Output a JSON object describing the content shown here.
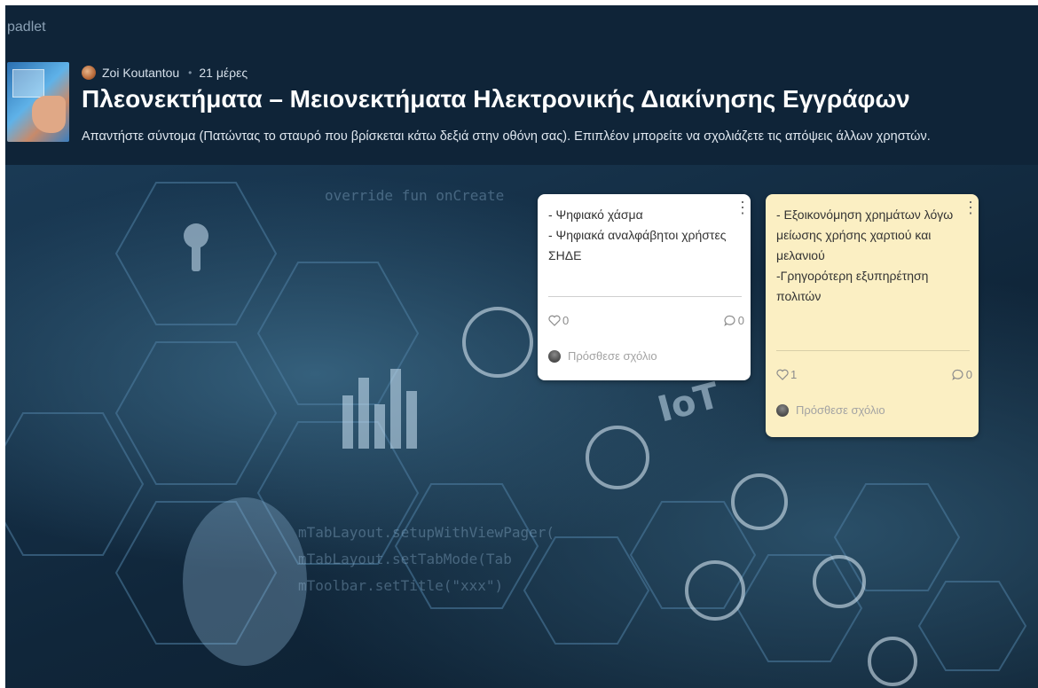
{
  "app": {
    "brand": "padlet"
  },
  "header": {
    "author": "Zoi Koutantou",
    "time_ago": "21 μέρες",
    "separator": "•",
    "title": "Πλεονεκτήματα – Μειονεκτήματα Ηλεκτρονικής Διακίνησης Εγγράφων",
    "subtitle": "Απαντήστε σύντομα (Πατώντας το σταυρό που βρίσκεται κάτω δεξιά στην οθόνη σας). Επιπλέον μπορείτε να σχολιάζετε τις απόψεις άλλων χρηστών."
  },
  "posts": [
    {
      "lines": [
        "- Ψηφιακό χάσμα",
        "- Ψηφιακά αναλφάβητοι χρήστες ΣΗΔΕ"
      ],
      "likes": "0",
      "comments": "0",
      "add_comment_placeholder": "Πρόσθεσε σχόλιο",
      "menu_icon": "⋮",
      "bg_color": "#ffffff"
    },
    {
      "lines": [
        "- Εξοικονόμηση χρημάτων λόγω μείωσης χρήσης χαρτιού και μελανιού",
        "-Γρηγορότερη εξυπηρέτηση πολιτών"
      ],
      "likes": "1",
      "comments": "0",
      "add_comment_placeholder": "Πρόσθεσε σχόλιο",
      "menu_icon": "⋮",
      "bg_color": "#fbefc3"
    }
  ],
  "icons": {
    "like": "heart-icon",
    "comment": "comment-bubble-icon",
    "menu": "more-vertical-icon"
  },
  "colors": {
    "header_bg": "#0f2438",
    "card_yellow": "#fbefc3",
    "card_white": "#ffffff"
  }
}
